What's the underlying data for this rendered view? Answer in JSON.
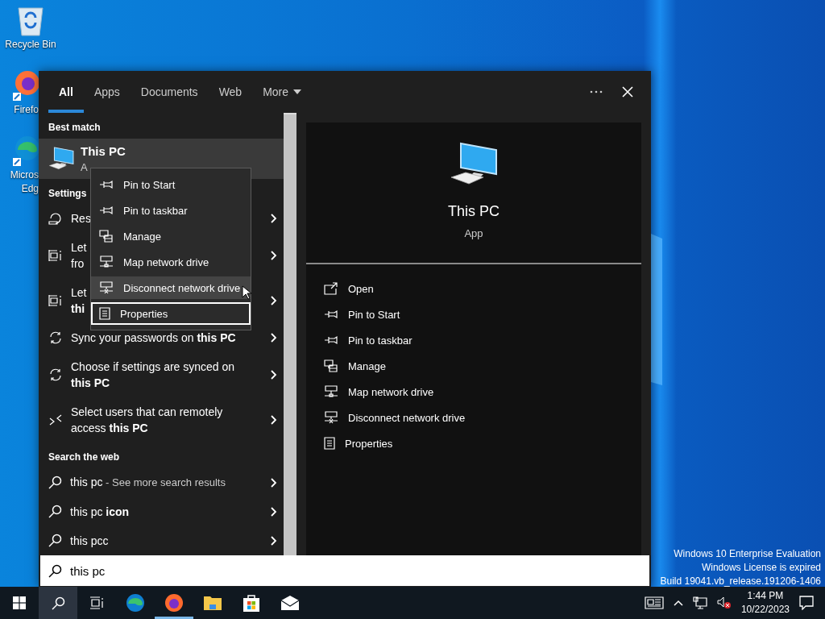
{
  "desktop_icons": [
    {
      "kind": "recycle",
      "lines": [
        "Recycle Bin"
      ]
    },
    {
      "kind": "firefox",
      "lines": [
        "Firefo"
      ]
    },
    {
      "kind": "edge",
      "lines": [
        "Micros",
        "Edg"
      ]
    }
  ],
  "activation_notice": [
    "Windows 10 Enterprise Evaluation",
    "Windows License is expired",
    "Build 19041.vb_release.191206-1406"
  ],
  "search_panel": {
    "tabs": [
      {
        "label": "All",
        "selected": true,
        "kind": "tab"
      },
      {
        "label": "Apps",
        "selected": false,
        "kind": "tab"
      },
      {
        "label": "Documents",
        "selected": false,
        "kind": "tab"
      },
      {
        "label": "Web",
        "selected": false,
        "kind": "tab"
      },
      {
        "label": "More",
        "selected": false,
        "kind": "dropdown"
      }
    ],
    "best_match": {
      "heading": "Best match",
      "title": "This PC",
      "subtitle": "A",
      "selected": true
    },
    "settings": {
      "heading": "Settings",
      "items": [
        {
          "kind": "restore",
          "lines": [
            "Res"
          ]
        },
        {
          "kind": "display",
          "lines": [
            "Let",
            "fro"
          ]
        },
        {
          "kind": "display",
          "lines": [
            "Let",
            "**thi**"
          ]
        },
        {
          "kind": "sync",
          "lines": [
            "Sync your passwords on **this PC**"
          ]
        },
        {
          "kind": "sync",
          "lines": [
            "Choose if settings are synced on",
            "**this PC**"
          ]
        },
        {
          "kind": "remote",
          "lines": [
            "Select users that can remotely",
            "access **this PC**"
          ]
        }
      ]
    },
    "web": {
      "heading": "Search the web",
      "items": [
        {
          "text": "this pc",
          "hint": "- See more search results"
        },
        {
          "text": "this pc **icon**"
        },
        {
          "text": "this pcc"
        }
      ]
    },
    "preview": {
      "title": "This PC",
      "subtitle": "App",
      "actions": [
        {
          "kind": "open",
          "label": "Open"
        },
        {
          "kind": "pin",
          "label": "Pin to Start"
        },
        {
          "kind": "pin",
          "label": "Pin to taskbar"
        },
        {
          "kind": "manage",
          "label": "Manage"
        },
        {
          "kind": "network",
          "label": "Map network drive"
        },
        {
          "kind": "disconnect",
          "label": "Disconnect network drive"
        },
        {
          "kind": "properties",
          "label": "Properties"
        }
      ]
    },
    "search_box": {
      "value": "this pc"
    }
  },
  "context_menu": {
    "items": [
      {
        "kind": "pin",
        "label": "Pin to Start",
        "selected": false,
        "focused": false
      },
      {
        "kind": "pin",
        "label": "Pin to taskbar",
        "selected": false,
        "focused": false
      },
      {
        "kind": "manage",
        "label": "Manage",
        "selected": false,
        "focused": false
      },
      {
        "kind": "network",
        "label": "Map network drive",
        "selected": false,
        "focused": false
      },
      {
        "kind": "disconnect",
        "label": "Disconnect network drive",
        "selected": true,
        "focused": false
      },
      {
        "kind": "properties",
        "label": "Properties",
        "selected": false,
        "focused": true
      }
    ]
  },
  "taskbar": {
    "buttons": [
      {
        "kind": "start",
        "active": false,
        "running": false
      },
      {
        "kind": "search",
        "active": true,
        "running": false
      },
      {
        "kind": "taskview",
        "active": false,
        "running": false
      },
      {
        "kind": "edge",
        "active": false,
        "running": false
      },
      {
        "kind": "firefox",
        "active": false,
        "running": true
      },
      {
        "kind": "folder",
        "active": false,
        "running": false
      },
      {
        "kind": "store",
        "active": false,
        "running": false
      },
      {
        "kind": "mail",
        "active": false,
        "running": false
      }
    ],
    "time": "1:44 PM",
    "date": "10/22/2023"
  }
}
